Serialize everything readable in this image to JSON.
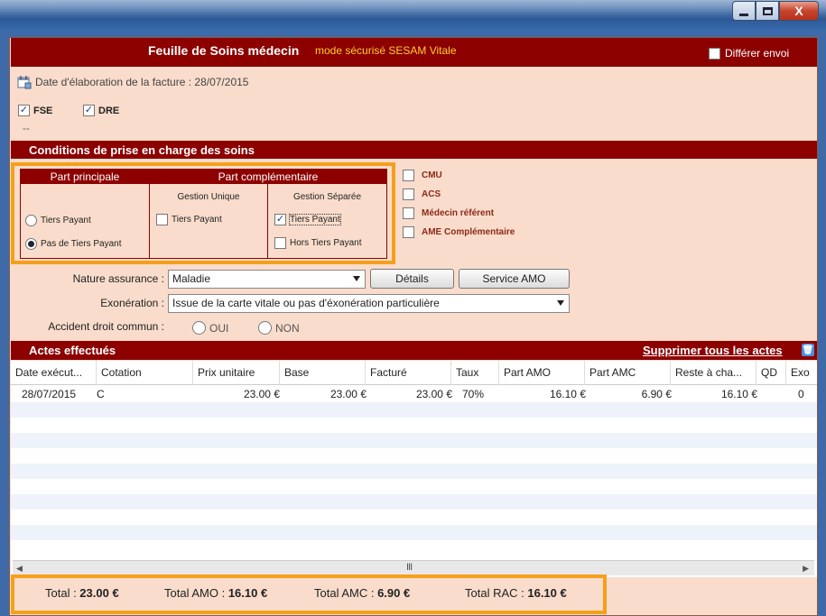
{
  "window": {
    "minimize": "—",
    "maximize": "☐",
    "close": "X"
  },
  "header": {
    "title": "Feuille de Soins médecin",
    "mode": "mode sécurisé SESAM Vitale",
    "differer_label": "Différer envoi",
    "differer_checked": false
  },
  "date_line": "Date d'élaboration de la facture : 28/07/2015",
  "flags": [
    {
      "label": "FSE",
      "checked": true
    },
    {
      "label": "DRE",
      "checked": true
    }
  ],
  "dashes": "--",
  "conditions": {
    "title": "Conditions de prise en charge des soins",
    "part_principale": {
      "title": "Part principale",
      "options": [
        "Tiers Payant",
        "Pas de Tiers Payant"
      ],
      "selected": "Pas de Tiers Payant"
    },
    "part_complementaire": {
      "title": "Part complémentaire",
      "gestion_unique": {
        "title": "Gestion Unique",
        "options": [
          {
            "label": "Tiers Payant",
            "checked": false
          }
        ]
      },
      "gestion_separee": {
        "title": "Gestion Séparée",
        "options": [
          {
            "label": "Tiers Payant",
            "checked": true
          },
          {
            "label": "Hors Tiers Payant",
            "checked": false
          }
        ]
      }
    },
    "extras": [
      {
        "label": "CMU",
        "checked": false
      },
      {
        "label": "ACS",
        "checked": false
      },
      {
        "label": "Médecin référent",
        "checked": false
      },
      {
        "label": "AME Complémentaire",
        "checked": false
      }
    ]
  },
  "form": {
    "nature_label": "Nature assurance :",
    "nature_value": "Maladie",
    "details_button": "Détails",
    "service_amo_button": "Service AMO",
    "exoneration_label": "Exonération :",
    "exoneration_value": "Issue de la carte vitale ou pas d'éxonération particulière",
    "accident_label": "Accident droit commun :",
    "oui": "OUI",
    "non": "NON"
  },
  "actes": {
    "title": "Actes effectués",
    "delete_all": "Supprimer tous les actes",
    "columns": [
      "Date exécut...",
      "Cotation",
      "Prix unitaire",
      "Base",
      "Facturé",
      "Taux",
      "Part AMO",
      "Part AMC",
      "Reste à cha...",
      "QD",
      "Exo"
    ],
    "rows": [
      [
        "28/07/2015",
        "C",
        "23.00 €",
        "23.00 €",
        "23.00 €",
        "70%",
        "16.10 €",
        "6.90 €",
        "16.10 €",
        "",
        "0"
      ]
    ],
    "scroll_thumb": "III"
  },
  "totals": [
    {
      "label": "Total : ",
      "value": "23.00 €"
    },
    {
      "label": "Total AMO : ",
      "value": "16.10 €"
    },
    {
      "label": "Total AMC : ",
      "value": "6.90 €"
    },
    {
      "label": "Total RAC : ",
      "value": "16.10 €"
    }
  ],
  "colors": {
    "accent": "#8c0000",
    "panel": "#f9dccb",
    "highlight": "#f5a01a",
    "mode_text": "#ffcc33"
  }
}
